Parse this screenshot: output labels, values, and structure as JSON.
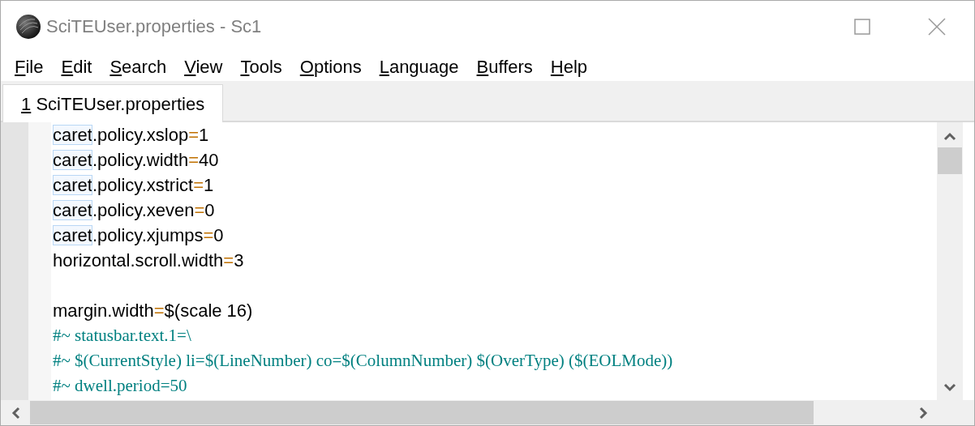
{
  "window": {
    "title": "SciTEUser.properties - Sc1"
  },
  "menu": [
    {
      "underlined": "F",
      "rest": "ile"
    },
    {
      "underlined": "E",
      "rest": "dit"
    },
    {
      "underlined": "S",
      "rest": "earch"
    },
    {
      "underlined": "V",
      "rest": "iew"
    },
    {
      "underlined": "T",
      "rest": "ools"
    },
    {
      "underlined": "O",
      "rest": "ptions"
    },
    {
      "underlined": "L",
      "rest": "anguage"
    },
    {
      "underlined": "B",
      "rest": "uffers"
    },
    {
      "underlined": "H",
      "rest": "elp"
    }
  ],
  "tabs": [
    {
      "number": "1",
      "label": "SciTEUser.properties",
      "selected": true
    }
  ],
  "editor": {
    "lines": [
      {
        "kind": "property",
        "key": [
          {
            "text": "caret",
            "highlighted": true
          },
          {
            "text": ".policy.xslop",
            "highlighted": false
          }
        ],
        "operator": "=",
        "value": "1"
      },
      {
        "kind": "property",
        "key": [
          {
            "text": "caret",
            "highlighted": true
          },
          {
            "text": ".policy.width",
            "highlighted": false
          }
        ],
        "operator": "=",
        "value": "40"
      },
      {
        "kind": "property",
        "key": [
          {
            "text": "caret",
            "highlighted": true
          },
          {
            "text": ".policy.xstrict",
            "highlighted": false
          }
        ],
        "operator": "=",
        "value": "1"
      },
      {
        "kind": "property",
        "key": [
          {
            "text": "caret",
            "highlighted": true
          },
          {
            "text": ".policy.xeven",
            "highlighted": false
          }
        ],
        "operator": "=",
        "value": "0"
      },
      {
        "kind": "property",
        "key": [
          {
            "text": "caret",
            "highlighted": true
          },
          {
            "text": ".policy.xjumps",
            "highlighted": false
          }
        ],
        "operator": "=",
        "value": "0"
      },
      {
        "kind": "property",
        "key": [
          {
            "text": "horizontal.scroll.width",
            "highlighted": false
          }
        ],
        "operator": "=",
        "value": "3"
      },
      {
        "kind": "blank"
      },
      {
        "kind": "property",
        "key": [
          {
            "text": "margin.width",
            "highlighted": false
          }
        ],
        "operator": "=",
        "value": "$(scale 16)"
      },
      {
        "kind": "comment",
        "text": "#~ statusbar.text.1=\\"
      },
      {
        "kind": "comment",
        "text": "#~ $(CurrentStyle) li=$(LineNumber) co=$(ColumnNumber) $(OverType) ($(EOLMode))"
      },
      {
        "kind": "comment",
        "text": "#~ dwell.period=50"
      }
    ]
  }
}
